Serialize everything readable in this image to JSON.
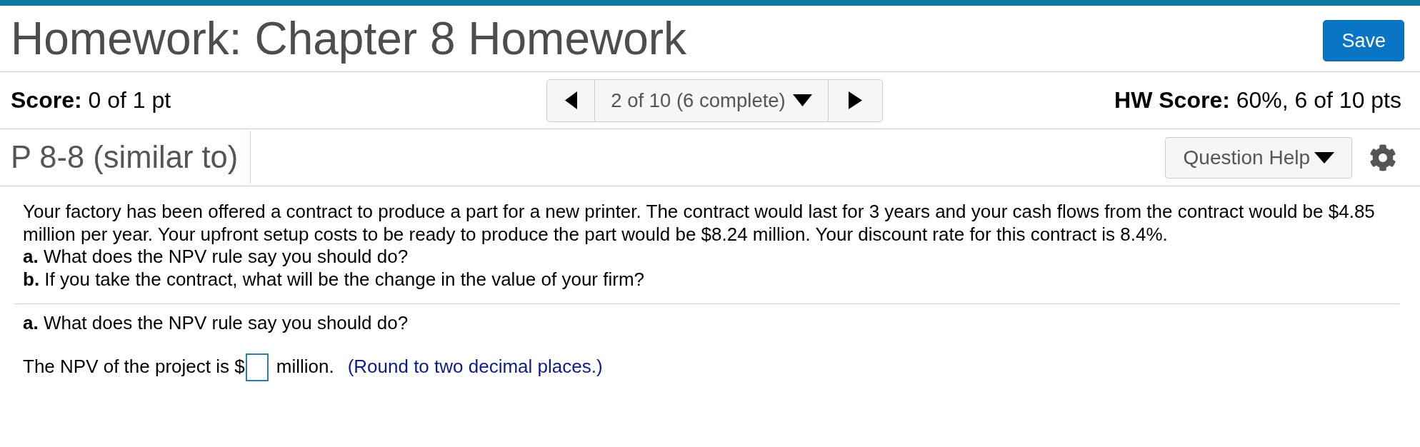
{
  "header": {
    "title": "Homework: Chapter 8 Homework",
    "save_button": "Save"
  },
  "score_bar": {
    "score": "**Score:** 0 of 1 pt",
    "navigator": {
      "label": "2 of 10 (6 complete)"
    },
    "hw_score": "**HW Score:** 60%, 6 of 10 pts"
  },
  "question_bar": {
    "title": "P 8-8 (similar to)",
    "help_button": "Question Help"
  },
  "problem": {
    "text": "Your factory has been offered a contract to produce a part for a new printer. The contract would last for 3 years and your cash flows from the contract would be $4.85 million per year. Your upfront setup costs to be ready to produce the part would be $8.24 million. Your discount rate for this contract is 8.4%.",
    "questions": [
      "**a.** What does the NPV rule say you should do?",
      "**b.** If you take the contract, what will be the change in the value of your firm?"
    ]
  },
  "answer": {
    "prompt": "**a.** What does the NPV rule say you should do?",
    "prefix": "The NPV of the project is $",
    "unit": "million.",
    "hint": "(Round to two decimal places.)"
  }
}
